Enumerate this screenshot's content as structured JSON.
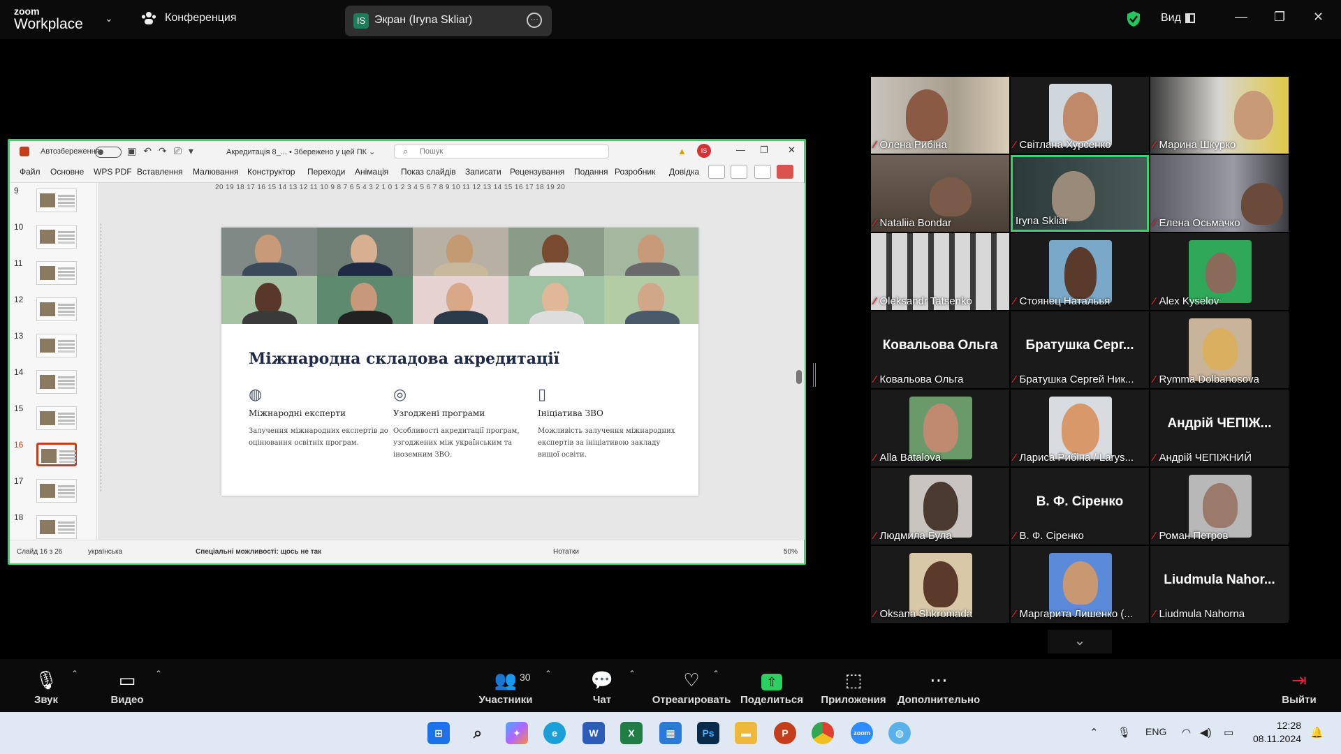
{
  "topbar": {
    "logo_line1": "zoom",
    "logo_line2": "Workplace",
    "conference_label": "Конференция",
    "share_label": "Экран (Iryna Skliar)",
    "share_badge": "IS",
    "view_label": "Вид"
  },
  "ppt": {
    "autosave_label": "Автозбереження",
    "file_name": "Акредитація 8_...",
    "saved_status": "• Збережено у цей ПК ⌄",
    "search_placeholder": "Пошук",
    "avatar_initials": "IS",
    "menu": [
      "Файл",
      "Основне",
      "WPS PDF",
      "Вставлення",
      "Малювання",
      "Конструктор",
      "Переходи",
      "Анімація",
      "Показ слайдів",
      "Записати",
      "Рецензування",
      "Подання",
      "Розробник",
      "Довідка"
    ],
    "thumb_numbers": [
      "9",
      "10",
      "11",
      "12",
      "13",
      "14",
      "15",
      "16",
      "17",
      "18"
    ],
    "active_thumb": "16",
    "ruler_text": "20 19 18 17 16 15 14 13 12 11 10 9 8 7 6 5 4 3 2 1 0 1 2 3 4 5 6 7 8 9 10 11 12 13 14 15 16 17 18 19 20",
    "status_slide": "Слайд 16 з 26",
    "status_lang": "українська",
    "status_accessibility": "Спеціальні можливості: щось не так",
    "status_notes": "Нотатки",
    "status_zoom": "50%"
  },
  "slide": {
    "title": "Міжнародна складова акредитації",
    "features": [
      {
        "icon": "globe-icon",
        "title": "Міжнародні експерти",
        "desc": "Залучення міжнародних експертів до оцінювання освітніх програм."
      },
      {
        "icon": "overlap-circles-icon",
        "title": "Узгоджені програми",
        "desc": "Особливості акредитації програм, узгоджених між українським та іноземним ЗВО."
      },
      {
        "icon": "document-icon",
        "title": "Ініціатива ЗВО",
        "desc": "Можливість залучення міжнародних експертів за ініціативою закладу вищої освіти."
      }
    ]
  },
  "participants": [
    {
      "name": "Олена Рибіна",
      "type": "video"
    },
    {
      "name": "Світлана Хурсенко",
      "type": "photo"
    },
    {
      "name": "Марина Шкурко",
      "type": "video"
    },
    {
      "name": "Nataliia Bondar",
      "type": "video"
    },
    {
      "name": "Iryna Skliar",
      "type": "video",
      "active": true
    },
    {
      "name": "Елена Осьмачко",
      "type": "video"
    },
    {
      "name": "Oleksandr Tatsenko",
      "type": "video"
    },
    {
      "name": "Стоянец Натальья",
      "type": "photo"
    },
    {
      "name": "Alex Kyselov",
      "type": "photo"
    },
    {
      "name": "Ковальова Ольга",
      "type": "text",
      "big": "Ковальова Ольга"
    },
    {
      "name": "Братушка Сергей Ник...",
      "type": "text",
      "big": "Братушка Серг..."
    },
    {
      "name": "Rymma Dolbanosova",
      "type": "photo"
    },
    {
      "name": "Alla Batalova",
      "type": "photo"
    },
    {
      "name": "Лариса Рибіна / Larys...",
      "type": "photo"
    },
    {
      "name": "Андрій ЧЕПІЖНИЙ",
      "type": "text",
      "big": "Андрій ЧЕПІЖ..."
    },
    {
      "name": "Людмила Була",
      "type": "photo"
    },
    {
      "name": "В. Ф. Сіренко",
      "type": "text",
      "big": "В. Ф. Сіренко"
    },
    {
      "name": "Роман Петров",
      "type": "photo"
    },
    {
      "name": "Oksana Shkromada",
      "type": "photo"
    },
    {
      "name": "Маргарита Лишенко (...",
      "type": "photo"
    },
    {
      "name": "Liudmula Nahorna",
      "type": "text",
      "big": "Liudmula Nahor..."
    }
  ],
  "controls": {
    "audio": "Звук",
    "video": "Видео",
    "participants": "Участники",
    "participants_count": "30",
    "chat": "Чат",
    "react": "Отреагировать",
    "share": "Поделиться",
    "apps": "Приложения",
    "more": "Дополнительно",
    "leave": "Выйти"
  },
  "taskbar": {
    "lang": "ENG",
    "time": "12:28",
    "date": "08.11.2024"
  },
  "colors": {
    "zoom_green": "#37d36b",
    "mute_red": "#e0243b",
    "ppt_accent": "#c43e1c",
    "share_green": "#2bd160"
  }
}
